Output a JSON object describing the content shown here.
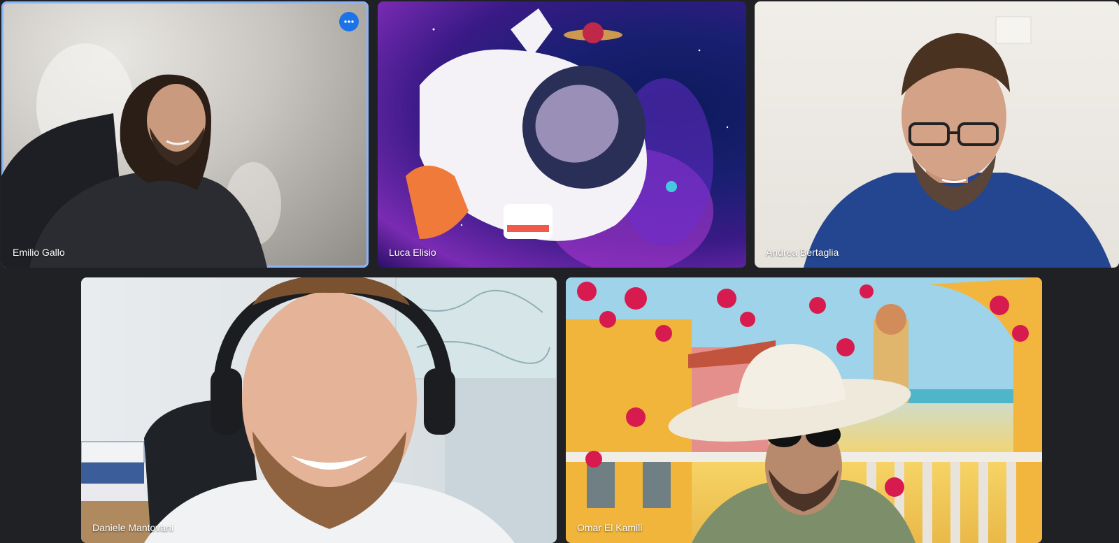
{
  "participants": [
    {
      "name": "Emilio Gallo",
      "active": true,
      "more_options": "more-options"
    },
    {
      "name": "Luca Elisio"
    },
    {
      "name": "Andrea Bertaglia"
    },
    {
      "name": "Daniele Mantovani"
    },
    {
      "name": "Omar El Kamili"
    }
  ],
  "colors": {
    "background": "#202124",
    "active_border": "#8ab4f8",
    "more_button": "#1a73e8"
  },
  "icons": {
    "more_options": "more-vert-icon"
  }
}
